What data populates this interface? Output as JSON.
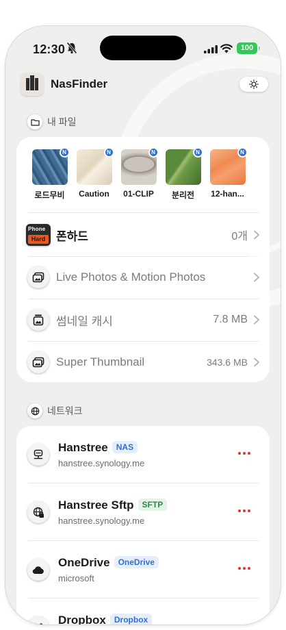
{
  "status_bar": {
    "time": "12:30",
    "battery": "100"
  },
  "app": {
    "title": "NasFinder"
  },
  "my_files": {
    "section_title": "내 파일",
    "thumbnails": [
      {
        "label": "로드무비",
        "badge": "N",
        "icon": "fabric-blue-thumbnail"
      },
      {
        "label": "Caution",
        "badge": "N",
        "icon": "cream-fabric-thumbnail"
      },
      {
        "label": "01-CLIP",
        "badge": "N",
        "icon": "stone-bowl-thumbnail"
      },
      {
        "label": "분리전",
        "badge": "N",
        "icon": "green-leaf-thumbnail"
      },
      {
        "label": "12-han...",
        "badge": "N",
        "icon": "orange-fabric-thumbnail"
      }
    ],
    "rows": [
      {
        "label": "폰하드",
        "value": "0개",
        "icon": "phone-hard-icon",
        "icon_text_top": "Phone",
        "icon_text_bottom": "Hard"
      },
      {
        "label": "Live Photos & Motion Photos",
        "value": "",
        "icon": "live-photos-icon"
      },
      {
        "label": "썸네일 캐시",
        "value": "7.8 MB",
        "icon": "thumbnail-cache-icon"
      },
      {
        "label": "Super Thumbnail",
        "value": "343.6 MB",
        "icon": "super-thumbnail-icon"
      }
    ]
  },
  "network": {
    "section_title": "네트워크",
    "servers": [
      {
        "name": "Hanstree",
        "tag": "NAS",
        "host": "hanstree.synology.me",
        "tag_color": "#2f6fd8",
        "icon": "server-icon"
      },
      {
        "name": "Hanstree Sftp",
        "tag": "SFTP",
        "host": "hanstree.synology.me",
        "tag_color": "#2f8b45",
        "icon": "globe-lock-icon"
      },
      {
        "name": "OneDrive",
        "tag": "OneDrive",
        "host": "microsoft",
        "tag_color": "#2f6fd8",
        "icon": "cloud-icon"
      },
      {
        "name": "Dropbox",
        "tag": "Dropbox",
        "host": "",
        "tag_color": "#2f6fd8",
        "icon": "dropbox-icon"
      }
    ]
  },
  "colors": {
    "accent_blue": "#2f6fd8",
    "more_red": "#e5322d",
    "battery_green": "#34c759"
  }
}
